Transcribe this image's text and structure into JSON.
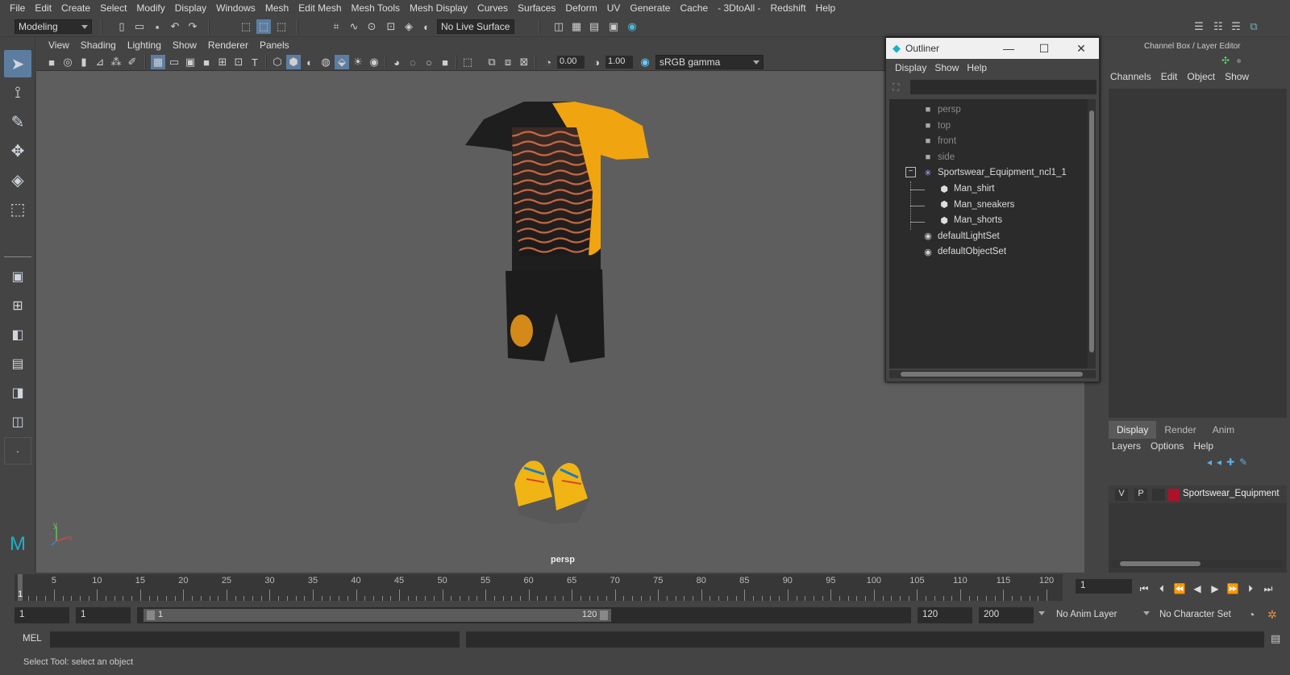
{
  "menubar": [
    "File",
    "Edit",
    "Create",
    "Select",
    "Modify",
    "Display",
    "Windows",
    "Mesh",
    "Edit Mesh",
    "Mesh Tools",
    "Mesh Display",
    "Curves",
    "Surfaces",
    "Deform",
    "UV",
    "Generate",
    "Cache",
    "- 3DtoAll -",
    "Redshift",
    "Help"
  ],
  "statusline": {
    "mode": "Modeling",
    "live_surface": "No Live Surface"
  },
  "viewport": {
    "menu": [
      "View",
      "Shading",
      "Lighting",
      "Show",
      "Renderer",
      "Panels"
    ],
    "exposure": "0.00",
    "gamma": "1.00",
    "colorspace": "sRGB gamma",
    "camera_label": "persp",
    "axis": {
      "y": "y",
      "x": "x"
    }
  },
  "outliner": {
    "title": "Outliner",
    "menu": [
      "Display",
      "Show",
      "Help"
    ],
    "search_value": "",
    "items": [
      {
        "label": "persp",
        "icon": "camera-icon",
        "dim": true
      },
      {
        "label": "top",
        "icon": "camera-icon",
        "dim": true
      },
      {
        "label": "front",
        "icon": "camera-icon",
        "dim": true
      },
      {
        "label": "side",
        "icon": "camera-icon",
        "dim": true
      },
      {
        "label": "Sportswear_Equipment_ncl1_1",
        "icon": "asterisk-icon",
        "dim": false
      },
      {
        "label": "Man_shirt",
        "icon": "mesh-icon",
        "dim": false
      },
      {
        "label": "Man_sneakers",
        "icon": "mesh-icon",
        "dim": false
      },
      {
        "label": "Man_shorts",
        "icon": "mesh-icon",
        "dim": false
      },
      {
        "label": "defaultLightSet",
        "icon": "set-icon",
        "dim": false
      },
      {
        "label": "defaultObjectSet",
        "icon": "set-icon",
        "dim": false
      }
    ]
  },
  "channelbox": {
    "title": "Channel Box / Layer Editor",
    "menu": [
      "Channels",
      "Edit",
      "Object",
      "Show"
    ],
    "tabs": [
      "Display",
      "Render",
      "Anim"
    ],
    "layer_menu": [
      "Layers",
      "Options",
      "Help"
    ],
    "layer": {
      "v": "V",
      "p": "P",
      "name": "Sportswear_Equipment",
      "color": "#b0102a"
    }
  },
  "timeline": {
    "ticks": [
      "5",
      "10",
      "15",
      "20",
      "25",
      "30",
      "35",
      "40",
      "45",
      "50",
      "55",
      "60",
      "65",
      "70",
      "75",
      "80",
      "85",
      "90",
      "95",
      "100",
      "105",
      "110",
      "115",
      "120"
    ],
    "current_frame_label": "1",
    "current_frame": "1"
  },
  "range": {
    "start": "1",
    "playback_start": "1",
    "slider_start": "1",
    "slider_end": "120",
    "playback_end": "120",
    "end": "200",
    "anim_layer": "No Anim Layer",
    "character_set": "No Character Set"
  },
  "cmdline": {
    "lang": "MEL"
  },
  "helpline": "Select Tool: select an object",
  "colors": {
    "accent": "#5d7da0",
    "ui_bg": "#444444",
    "viewport_bg": "#5e5e5e",
    "shirt_orange": "#f0a410"
  }
}
